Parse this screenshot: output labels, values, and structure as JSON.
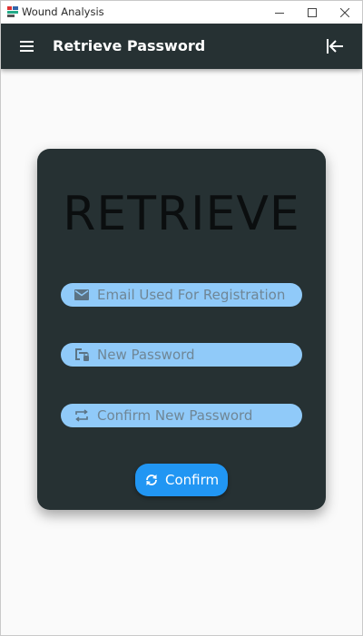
{
  "window": {
    "title": "Wound Analysis",
    "icon": "app-icon",
    "controls": [
      "minimize-icon",
      "maximize-icon",
      "close-icon"
    ]
  },
  "appbar": {
    "title": "Retrieve Password",
    "menu_icon": "menu-icon",
    "logout_icon": "logout-icon",
    "background": "#263133"
  },
  "card": {
    "title": "RETRIEVE",
    "background": "#263133",
    "fields": [
      {
        "icon": "email-icon",
        "placeholder": "Email Used For Registration",
        "value": ""
      },
      {
        "icon": "password-reset-icon",
        "placeholder": "New Password",
        "value": ""
      },
      {
        "icon": "repeat-icon",
        "placeholder": "Confirm New Password",
        "value": ""
      }
    ],
    "field_background": "#90caf9",
    "button": {
      "label": "Confirm",
      "icon": "refresh-icon",
      "background": "#2196f3"
    }
  }
}
